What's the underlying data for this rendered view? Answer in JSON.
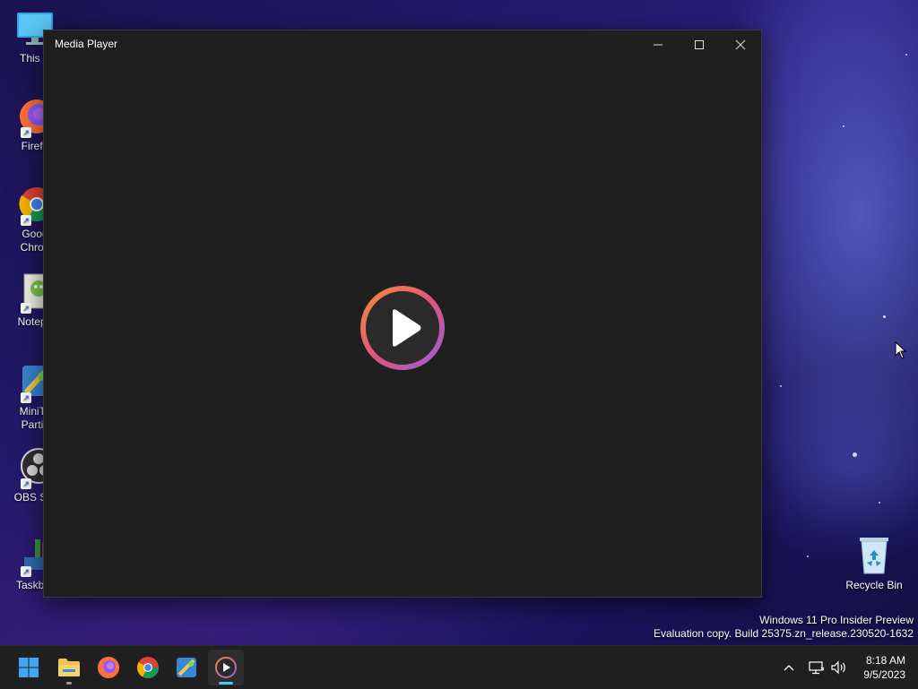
{
  "desktop": {
    "icons": [
      {
        "label": "This P",
        "icon": "this-pc-icon"
      },
      {
        "label": "Firefo",
        "icon": "firefox-icon"
      },
      {
        "label": "Goog\nChron",
        "icon": "chrome-icon"
      },
      {
        "label": "Notepa",
        "icon": "notepad-plus-plus-icon"
      },
      {
        "label": "MiniTo\nPartiti",
        "icon": "minitool-partition-icon"
      },
      {
        "label": "OBS Stu",
        "icon": "obs-studio-icon"
      },
      {
        "label": "Taskbar",
        "icon": "taskbar-app-icon"
      }
    ],
    "recycle_bin": {
      "label": "Recycle Bin",
      "icon": "recycle-bin-icon"
    },
    "watermark": {
      "line1": "Windows 11 Pro Insider Preview",
      "line2": "Evaluation copy. Build 25375.zn_release.230520-1632"
    }
  },
  "window": {
    "title": "Media Player",
    "controls": {
      "minimize": "minimize-icon",
      "maximize": "maximize-icon",
      "close": "close-icon"
    },
    "play_button": {
      "icon": "play-icon",
      "ring_colors": [
        "#f28b3c",
        "#e0567a",
        "#9a5bd6"
      ]
    }
  },
  "taskbar": {
    "apps": [
      {
        "name": "Start",
        "icon": "windows-start-icon"
      },
      {
        "name": "File Explorer",
        "icon": "file-explorer-icon"
      },
      {
        "name": "Firefox",
        "icon": "firefox-icon"
      },
      {
        "name": "Google Chrome",
        "icon": "chrome-icon"
      },
      {
        "name": "MiniTool",
        "icon": "minitool-icon"
      },
      {
        "name": "Media Player",
        "icon": "media-player-icon"
      }
    ],
    "tray": {
      "chevron": "chevron-up-icon",
      "network": "network-icon",
      "volume": "volume-icon"
    },
    "clock": {
      "time": "8:18 AM",
      "date": "9/5/2023"
    }
  },
  "colors": {
    "window_bg": "#1f1f1f",
    "taskbar_bg": "#202020",
    "accent": "#4cc2ff"
  }
}
